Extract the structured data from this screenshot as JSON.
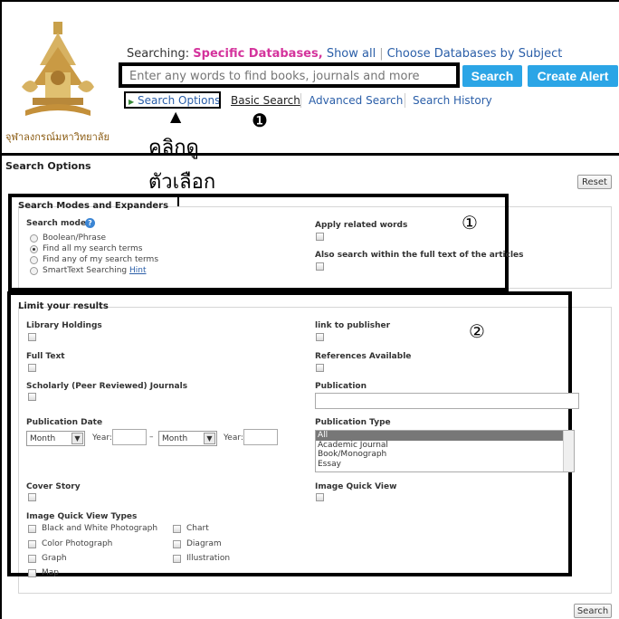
{
  "header": {
    "logo_caption": "จุฬาลงกรณ์มหาวิทยาลัย",
    "searching_prefix": "Searching:",
    "searching_db": "Specific Databases,",
    "show_all": "Show all",
    "choose_db": "Choose Databases by Subject",
    "search_placeholder": "Enter any words to find books, journals and more",
    "search_button": "Search",
    "create_alert_button": "Create Alert",
    "nav": {
      "search_options": "Search Options",
      "basic_search": "Basic Search",
      "advanced_search": "Advanced Search",
      "search_history": "Search History"
    }
  },
  "annotations": {
    "click_line1": "คลิกดู",
    "click_line2": "ตัวเลือก",
    "marker_1": "❶",
    "marker_circle1": "①",
    "marker_circle2": "②",
    "arrow_up": "▲",
    "arrow_down": "▼"
  },
  "search_options": {
    "title": "Search Options",
    "reset_button": "Reset",
    "bottom_search_button": "Search",
    "modes_section": {
      "title": "Search Modes and Expanders",
      "search_modes_label": "Search modes",
      "help_icon": "?",
      "modes": [
        {
          "label": "Boolean/Phrase",
          "selected": false
        },
        {
          "label": "Find all my search terms",
          "selected": true
        },
        {
          "label": "Find any of my search terms",
          "selected": false
        },
        {
          "label": "SmartText Searching",
          "selected": false
        }
      ],
      "hint_link": "Hint",
      "apply_related_words": "Apply related words",
      "full_text_articles": "Also search within the full text of the articles"
    },
    "limit_section": {
      "title": "Limit your results",
      "library_holdings": "Library Holdings",
      "link_to_publisher": "link to publisher",
      "full_text": "Full Text",
      "references_available": "References Available",
      "scholarly": "Scholarly (Peer Reviewed) Journals",
      "publication": "Publication",
      "publication_date": "Publication Date",
      "month_label": "Month",
      "year_label": "Year:",
      "dash": "–",
      "publication_type": "Publication Type",
      "publication_types": [
        "All",
        "Academic Journal",
        "Book/Monograph",
        "Essay"
      ],
      "cover_story": "Cover Story",
      "image_quick_view": "Image Quick View",
      "iqv_types_title": "Image Quick View Types",
      "iqv_types_left": [
        "Black and White Photograph",
        "Color Photograph",
        "Graph",
        "Map"
      ],
      "iqv_types_right": [
        "Chart",
        "Diagram",
        "Illustration"
      ]
    }
  }
}
